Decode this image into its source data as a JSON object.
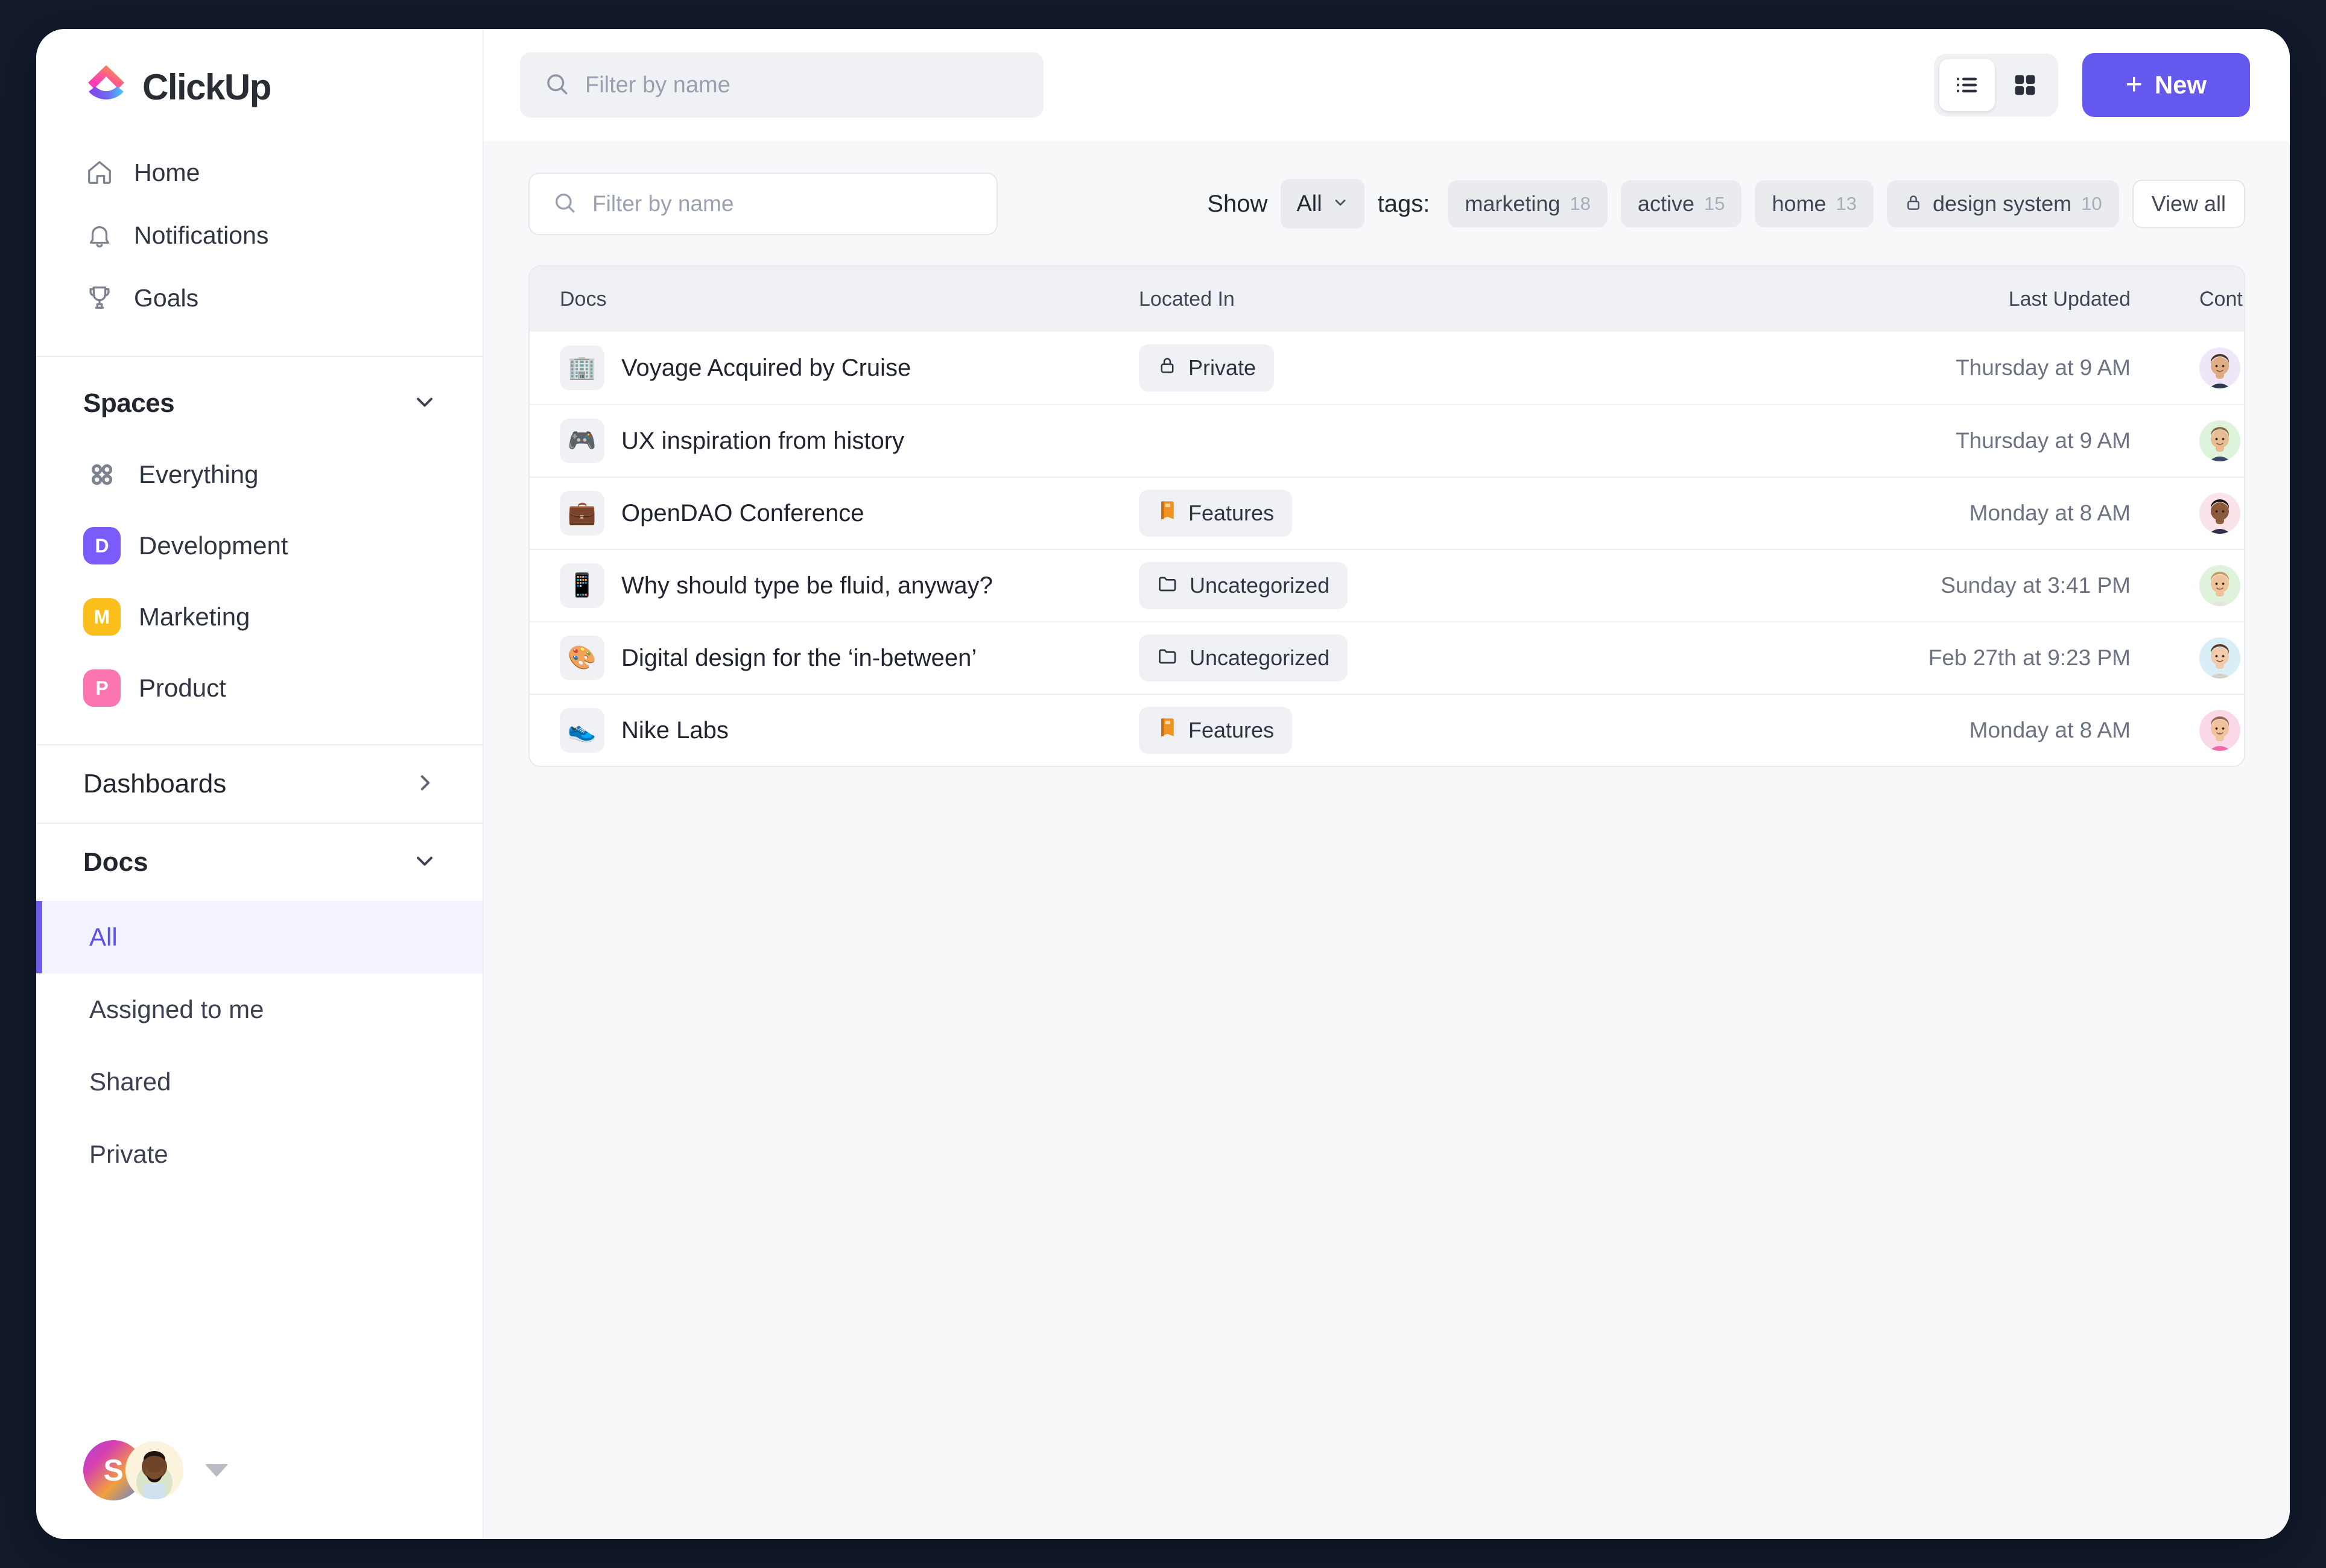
{
  "app": {
    "name": "ClickUp",
    "workspace_initial": "S"
  },
  "sidebar": {
    "nav": [
      {
        "label": "Home",
        "icon": "home-icon"
      },
      {
        "label": "Notifications",
        "icon": "bell-icon"
      },
      {
        "label": "Goals",
        "icon": "trophy-icon"
      }
    ],
    "spaces": {
      "title": "Spaces",
      "everything_label": "Everything",
      "items": [
        {
          "label": "Development",
          "initial": "D",
          "color": "#7B5CFA"
        },
        {
          "label": "Marketing",
          "initial": "M",
          "color": "#FBBF1C"
        },
        {
          "label": "Product",
          "initial": "P",
          "color": "#FB76B0"
        }
      ]
    },
    "dashboards": {
      "label": "Dashboards"
    },
    "docs": {
      "title": "Docs",
      "items": [
        {
          "label": "All",
          "active": true
        },
        {
          "label": "Assigned to me",
          "active": false
        },
        {
          "label": "Shared",
          "active": false
        },
        {
          "label": "Private",
          "active": false
        }
      ]
    }
  },
  "topbar": {
    "search_placeholder": "Filter by name",
    "view_list": "list-view",
    "view_grid": "grid-view",
    "active_view": "list",
    "new_label": "New",
    "new_plus": "+",
    "accent": "#6458EE"
  },
  "filters": {
    "search_placeholder": "Filter by name",
    "show_label": "Show",
    "show_value": "All",
    "tags_label": "tags:",
    "tags": [
      {
        "name": "marketing",
        "count": "18",
        "locked": false
      },
      {
        "name": "active",
        "count": "15",
        "locked": false
      },
      {
        "name": "home",
        "count": "13",
        "locked": false
      },
      {
        "name": "design system",
        "count": "10",
        "locked": true
      }
    ],
    "view_all_label": "View all"
  },
  "table": {
    "columns": [
      "Docs",
      "Located In",
      "Last Updated",
      "Contributors"
    ],
    "rows": [
      {
        "icon": "🏢",
        "name": "Voyage Acquired by Cruise",
        "located_in": "Private",
        "located_icon": "lock",
        "updated": "Thursday at 9 AM",
        "avatar_bg": "#EFE7F8",
        "avatar_skin": "#E0AC84",
        "avatar_hair": "#4A3728",
        "avatar_shirt": "#2F3A52",
        "share": false
      },
      {
        "icon": "🎮",
        "name": "UX inspiration from history",
        "located_in": "",
        "located_icon": "none",
        "updated": "Thursday at 9 AM",
        "avatar_bg": "#DDF3DC",
        "avatar_skin": "#E8BC94",
        "avatar_hair": "#8A6A3E",
        "avatar_shirt": "#3A4A66",
        "share": false
      },
      {
        "icon": "💼",
        "name": "OpenDAO Conference",
        "located_in": "Features",
        "located_icon": "book",
        "updated": "Monday at 8 AM",
        "avatar_bg": "#FBE3EA",
        "avatar_skin": "#8A5A3B",
        "avatar_hair": "#1E1410",
        "avatar_shirt": "#2B3247",
        "share": false
      },
      {
        "icon": "📱",
        "name": "Why should type be fluid, anyway?",
        "located_in": "Uncategorized",
        "located_icon": "folder",
        "updated": "Sunday at 3:41 PM",
        "avatar_bg": "#DFF2DC",
        "avatar_skin": "#EEC39C",
        "avatar_hair": "#C79B63",
        "avatar_shirt": "#E8E4DE",
        "share": false
      },
      {
        "icon": "🎨",
        "name": "Digital design for the ‘in-between’",
        "located_in": "Uncategorized",
        "located_icon": "folder",
        "updated": "Feb 27th at 9:23 PM",
        "avatar_bg": "#D9EFF7",
        "avatar_skin": "#F2CBAC",
        "avatar_hair": "#5A3A24",
        "avatar_shirt": "#D8CFC6",
        "share": false
      },
      {
        "icon": "👟",
        "name": "Nike Labs",
        "located_in": "Features",
        "located_icon": "book",
        "updated": "Monday at 8 AM",
        "avatar_bg": "#FBD8E8",
        "avatar_skin": "#F0C29C",
        "avatar_hair": "#9A6A44",
        "avatar_shirt": "#F06AA8",
        "share": true,
        "share_icon": "share-icon"
      }
    ],
    "row_menu_icon": "more-options-icon"
  }
}
